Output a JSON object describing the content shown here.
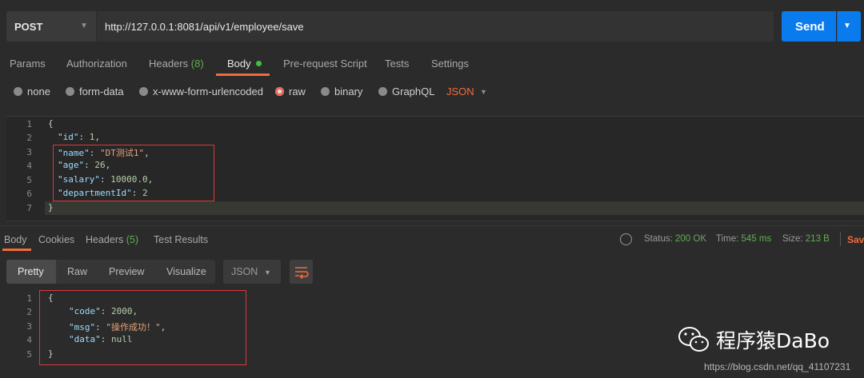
{
  "request": {
    "method": "POST",
    "url": "http://127.0.0.1:8081/api/v1/employee/save",
    "send_label": "Send"
  },
  "request_tabs": {
    "params": "Params",
    "authorization": "Authorization",
    "headers": "Headers",
    "headers_count": "(8)",
    "body": "Body",
    "prerequest": "Pre-request Script",
    "tests": "Tests",
    "settings": "Settings"
  },
  "body_types": {
    "none": "none",
    "form_data": "form-data",
    "urlencoded": "x-www-form-urlencoded",
    "raw": "raw",
    "binary": "binary",
    "graphql": "GraphQL",
    "format": "JSON",
    "selected": "raw"
  },
  "request_body": {
    "line_numbers": [
      "1",
      "2",
      "3",
      "4",
      "5",
      "6",
      "7"
    ],
    "open": "{",
    "close": "}",
    "id_key": "\"id\"",
    "id_val": "1",
    "name_key": "\"name\"",
    "name_val": "\"DT测试1\"",
    "age_key": "\"age\"",
    "age_val": "26",
    "salary_key": "\"salary\"",
    "salary_val": "10000.0",
    "dept_key": "\"departmentId\"",
    "dept_val": "2"
  },
  "response_tabs": {
    "body": "Body",
    "cookies": "Cookies",
    "headers": "Headers",
    "headers_count": "(5)",
    "test_results": "Test Results"
  },
  "response_status": {
    "status_label": "Status:",
    "status_value": "200 OK",
    "time_label": "Time:",
    "time_value": "545 ms",
    "size_label": "Size:",
    "size_value": "213 B",
    "save_label": "Save"
  },
  "view_modes": {
    "pretty": "Pretty",
    "raw": "Raw",
    "preview": "Preview",
    "visualize": "Visualize",
    "format": "JSON"
  },
  "response_body": {
    "line_numbers": [
      "1",
      "2",
      "3",
      "4",
      "5"
    ],
    "open": "{",
    "close": "}",
    "code_key": "\"code\"",
    "code_val": "2000",
    "msg_key": "\"msg\"",
    "msg_val": "\"操作成功！\"",
    "data_key": "\"data\"",
    "data_val": "null"
  },
  "watermark": {
    "brand": "程序猿DaBo",
    "url": "https://blog.csdn.net/qq_41107231"
  },
  "colors": {
    "accent": "#f26b3a",
    "send": "#097bed",
    "ok": "#5fae52",
    "highlight_box": "#d8393a"
  }
}
